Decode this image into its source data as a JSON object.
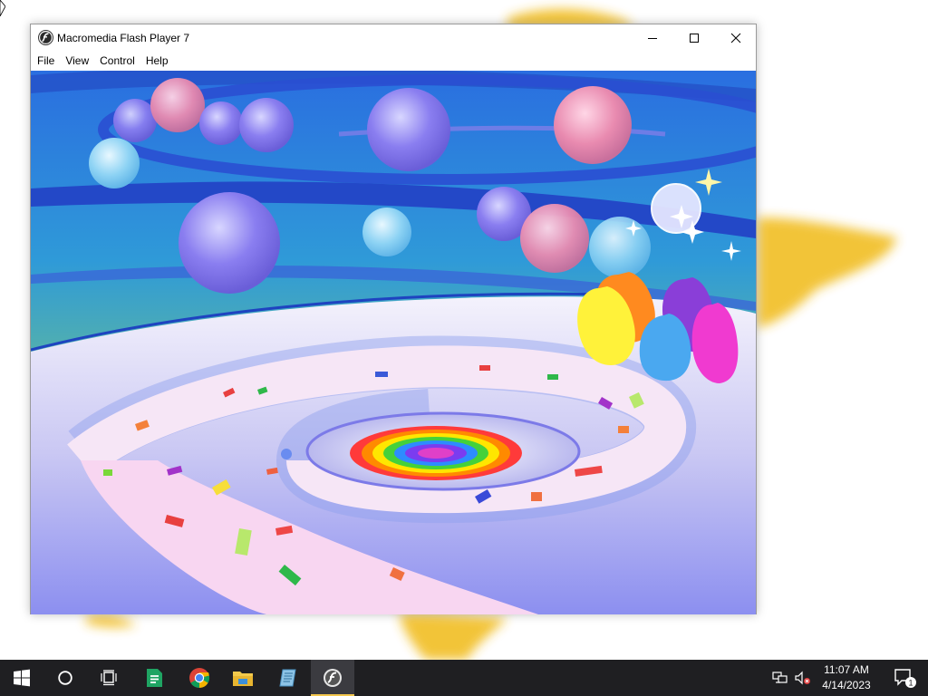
{
  "window": {
    "title": "Macromedia Flash Player 7",
    "icon": "flash-icon",
    "controls": [
      "minimize-icon",
      "maximize-icon",
      "close-icon"
    ]
  },
  "menu": {
    "items": [
      "File",
      "View",
      "Control",
      "Help"
    ]
  },
  "taskbar": {
    "icons": [
      "windows-start-icon",
      "cortana-search-icon",
      "task-view-icon",
      "spreadsheet-app-icon",
      "chrome-icon",
      "file-explorer-icon",
      "notepad-icon",
      "flash-player-icon"
    ],
    "active_app": "flash-player-icon",
    "tray_icons": [
      "network-icon",
      "volume-muted-icon"
    ],
    "time": "11:07 AM",
    "date": "4/14/2023",
    "notification_count": "1"
  },
  "colors": {
    "taskbar_bg": "#1f1f22",
    "active_indicator": "#f3c64d",
    "wallpaper_blob": "#f2c12e",
    "sky_top": "#2a6ee0",
    "stage_ground": "#dcd8f6"
  }
}
